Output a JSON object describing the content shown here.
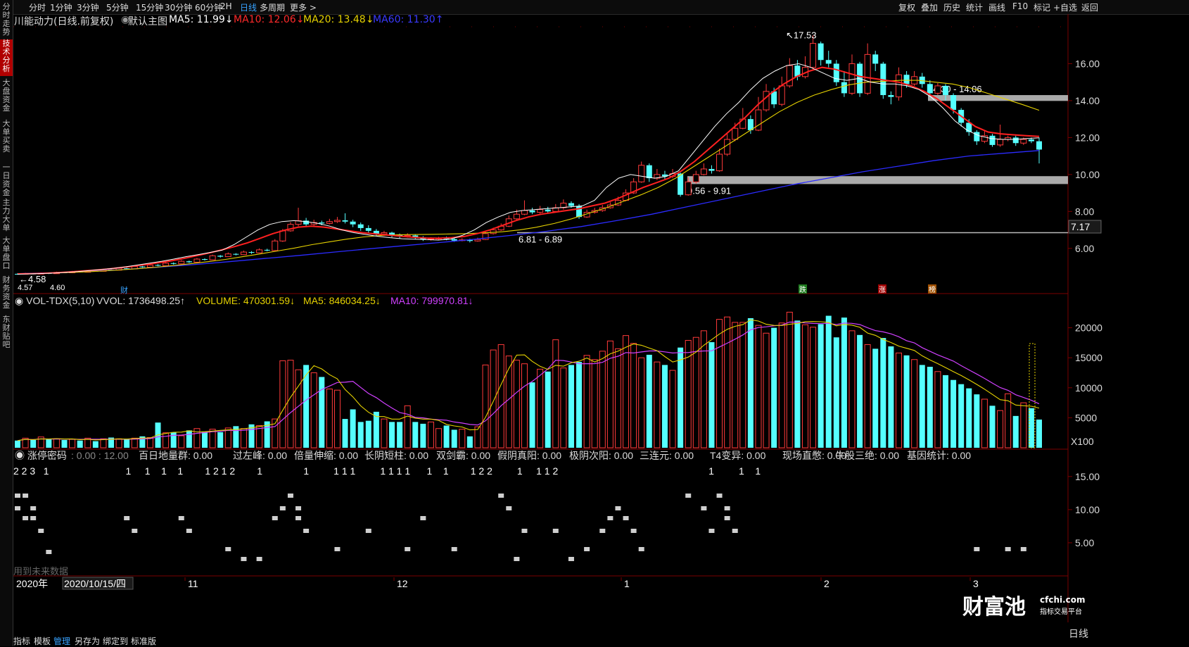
{
  "sidebar": {
    "tabs": [
      {
        "label": "分时走势",
        "active": false
      },
      {
        "label": "技术分析",
        "active": true
      },
      {
        "label": "大盘资金",
        "active": false
      },
      {
        "label": "大单买卖",
        "active": false
      },
      {
        "label": "一日资金",
        "active": false
      },
      {
        "label": "主力大单",
        "active": false
      },
      {
        "label": "大单盘口",
        "active": false
      },
      {
        "label": "财务资金",
        "active": false
      },
      {
        "label": "东财贴吧",
        "active": false
      }
    ]
  },
  "topbar": {
    "periods": [
      "分时",
      "1分钟",
      "3分钟",
      "5分钟",
      "15分钟",
      "30分钟",
      "60分钟",
      "2H",
      "日线",
      "多周期",
      "更多 >"
    ],
    "selected_period": "日线",
    "tools": [
      "复权",
      "叠加",
      "历史",
      "统计",
      "画线",
      "F10",
      "标记",
      "+自选",
      "返回"
    ]
  },
  "main_indicator": {
    "stock": "川能动力(日线.前复权)",
    "mode": "默认主图",
    "ma5": "MA5: 11.99↓",
    "ma10": "MA10: 12.06↓",
    "ma20": "MA20: 13.48↓",
    "ma60": "MA60: 11.30↑",
    "colors": {
      "ma5": "#ffffff",
      "ma10": "#ff2a2a",
      "ma20": "#e6d200",
      "ma60": "#3a3aff"
    }
  },
  "price_axis": [
    "16.00",
    "14.00",
    "12.00",
    "10.00",
    "8.00",
    "6.00"
  ],
  "current_price_tag": "7.17",
  "annotations": {
    "high": "17.53",
    "low1": "4.58",
    "low2": "4.57",
    "low3": "4.60",
    "zone1": "14.30 - 14.06",
    "zone2": "9.56 - 9.91",
    "zone3": "6.81 - 6.89",
    "tag_cai": "财",
    "tag_die": "跌",
    "tag_zhang": "涨",
    "tag_bang": "榜"
  },
  "volume_indicator": {
    "name": "VOL-TDX(5,10)",
    "vvol": "VVOL: 1736498.25↑",
    "volume": "VOLUME: 470301.59↓",
    "ma5": "MA5: 846034.25↓",
    "ma10": "MA10: 799970.81↓",
    "axis": [
      "20000",
      "15000",
      "10000",
      "5000"
    ],
    "unit": "X100"
  },
  "code_indicator": {
    "name": "涨停密码",
    "range": ": 0.00 : 12.00",
    "items": [
      "百日地量群: 0.00",
      "过左峰: 0.00",
      "倍量伸缩: 0.00",
      "长阴短柱: 0.00",
      "双剑霸: 0.00",
      "假阴真阳: 0.00",
      "极阴次阳: 0.00",
      "三连元: 0.00",
      "T4变异: 0.00",
      "现场直憋: 0.00",
      "牛股三绝: 0.00",
      "基因统计: 0.00"
    ],
    "axis": [
      "15.00",
      "10.00",
      "5.00"
    ],
    "digits": "2 2 3   1                            1     1    1    1        1 2 1 2        1               1         1 1 1         1 1 1 1      1    1        1 2 2         1     1 1 2                                                       1         1    1",
    "footnote": "用到未来数据"
  },
  "time_axis": {
    "year": "2020年",
    "cursor_date": "2020/10/15/四",
    "months": [
      "11",
      "12",
      "1",
      "2",
      "3"
    ]
  },
  "bottom_tabs": [
    "指标",
    "模板",
    "管理",
    "另存为",
    "绑定到",
    "标准版"
  ],
  "selected_bottom_tab": "管理",
  "period_label": "日线",
  "logo": {
    "name": "财富池",
    "site": "cfchi.com",
    "slogan": "指标交易平台"
  },
  "chart_data": {
    "type": "candlestick",
    "y_price_range": [
      4.2,
      18.0
    ],
    "candles": [
      [
        4.62,
        4.58,
        4.66,
        4.57
      ],
      [
        4.6,
        4.64,
        4.68,
        4.58
      ],
      [
        4.63,
        4.61,
        4.67,
        4.59
      ],
      [
        4.61,
        4.66,
        4.7,
        4.6
      ],
      [
        4.66,
        4.63,
        4.69,
        4.61
      ],
      [
        4.63,
        4.7,
        4.74,
        4.62
      ],
      [
        4.7,
        4.68,
        4.73,
        4.66
      ],
      [
        4.68,
        4.74,
        4.78,
        4.67
      ],
      [
        4.74,
        4.71,
        4.76,
        4.69
      ],
      [
        4.71,
        4.78,
        4.82,
        4.7
      ],
      [
        4.78,
        4.76,
        4.81,
        4.74
      ],
      [
        4.76,
        4.85,
        4.9,
        4.75
      ],
      [
        4.85,
        4.82,
        4.88,
        4.8
      ],
      [
        4.82,
        4.92,
        4.96,
        4.81
      ],
      [
        4.92,
        4.89,
        4.95,
        4.86
      ],
      [
        4.89,
        5.02,
        5.08,
        4.88
      ],
      [
        5.02,
        4.98,
        5.05,
        4.95
      ],
      [
        4.98,
        5.1,
        5.15,
        4.97
      ],
      [
        5.1,
        5.06,
        5.14,
        5.03
      ],
      [
        5.06,
        5.2,
        5.26,
        5.05
      ],
      [
        5.2,
        5.16,
        5.24,
        5.12
      ],
      [
        5.16,
        5.3,
        5.36,
        5.15
      ],
      [
        5.3,
        5.25,
        5.34,
        5.21
      ],
      [
        5.25,
        5.42,
        5.48,
        5.24
      ],
      [
        5.42,
        5.38,
        5.46,
        5.34
      ],
      [
        5.38,
        5.6,
        5.66,
        5.37
      ],
      [
        5.6,
        5.55,
        5.64,
        5.5
      ],
      [
        5.55,
        5.7,
        5.78,
        5.54
      ],
      [
        5.7,
        5.66,
        5.74,
        5.62
      ],
      [
        5.66,
        5.8,
        5.88,
        5.65
      ],
      [
        5.8,
        5.76,
        5.85,
        5.7
      ],
      [
        5.76,
        5.92,
        6.0,
        5.74
      ],
      [
        5.92,
        5.88,
        5.98,
        5.84
      ],
      [
        5.88,
        6.4,
        6.5,
        5.86
      ],
      [
        6.4,
        6.95,
        7.05,
        6.35
      ],
      [
        6.95,
        7.3,
        7.42,
        6.9
      ],
      [
        7.3,
        7.5,
        8.2,
        7.2
      ],
      [
        7.5,
        7.3,
        7.65,
        7.15
      ],
      [
        7.3,
        7.4,
        7.55,
        7.22
      ],
      [
        7.4,
        7.35,
        7.5,
        7.25
      ],
      [
        7.35,
        7.45,
        7.6,
        7.3
      ],
      [
        7.45,
        7.52,
        7.7,
        7.38
      ],
      [
        7.52,
        7.45,
        7.9,
        7.35
      ],
      [
        7.45,
        7.3,
        7.55,
        7.15
      ],
      [
        7.3,
        7.1,
        7.4,
        6.95
      ],
      [
        7.1,
        6.95,
        7.25,
        6.8
      ],
      [
        6.95,
        6.78,
        7.05,
        6.7
      ],
      [
        6.78,
        6.85,
        6.95,
        6.68
      ],
      [
        6.85,
        6.72,
        6.9,
        6.6
      ],
      [
        6.72,
        6.65,
        6.8,
        6.55
      ],
      [
        6.65,
        6.7,
        6.82,
        6.58
      ],
      [
        6.7,
        6.6,
        6.76,
        6.5
      ],
      [
        6.6,
        6.48,
        6.66,
        6.4
      ],
      [
        6.48,
        6.52,
        6.6,
        6.42
      ],
      [
        6.52,
        6.55,
        6.62,
        6.45
      ],
      [
        6.55,
        6.5,
        6.64,
        6.44
      ],
      [
        6.5,
        6.42,
        6.58,
        6.35
      ],
      [
        6.42,
        6.46,
        6.55,
        6.38
      ],
      [
        6.46,
        6.4,
        6.52,
        6.32
      ],
      [
        6.4,
        6.48,
        6.58,
        6.36
      ],
      [
        6.48,
        6.8,
        6.92,
        6.45
      ],
      [
        6.8,
        7.0,
        7.12,
        6.75
      ],
      [
        7.0,
        7.2,
        7.35,
        6.95
      ],
      [
        7.2,
        7.6,
        7.78,
        7.15
      ],
      [
        7.6,
        7.85,
        8.1,
        7.55
      ],
      [
        7.85,
        8.05,
        8.6,
        7.8
      ],
      [
        8.05,
        7.95,
        8.2,
        7.85
      ],
      [
        7.95,
        8.1,
        8.3,
        7.88
      ],
      [
        8.1,
        8.0,
        8.25,
        7.9
      ],
      [
        8.0,
        8.2,
        8.4,
        7.95
      ],
      [
        8.2,
        8.45,
        8.65,
        8.1
      ],
      [
        8.45,
        8.3,
        8.55,
        8.2
      ],
      [
        8.3,
        7.7,
        8.4,
        7.6
      ],
      [
        7.7,
        7.95,
        8.1,
        7.65
      ],
      [
        7.95,
        8.05,
        8.2,
        7.88
      ],
      [
        8.05,
        8.2,
        8.35,
        7.98
      ],
      [
        8.2,
        8.35,
        8.5,
        8.15
      ],
      [
        8.35,
        8.6,
        8.8,
        8.3
      ],
      [
        8.6,
        9.0,
        9.2,
        8.55
      ],
      [
        9.0,
        9.6,
        9.8,
        8.95
      ],
      [
        9.6,
        10.5,
        10.7,
        9.55
      ],
      [
        10.5,
        9.8,
        10.6,
        9.6
      ],
      [
        9.8,
        10.0,
        10.3,
        9.7
      ],
      [
        10.0,
        9.9,
        10.2,
        9.75
      ],
      [
        9.9,
        10.05,
        10.3,
        9.8
      ],
      [
        10.05,
        8.9,
        10.1,
        8.8
      ],
      [
        8.9,
        9.6,
        9.85,
        8.85
      ],
      [
        9.6,
        10.0,
        10.2,
        9.5
      ],
      [
        10.0,
        10.3,
        10.6,
        9.95
      ],
      [
        10.3,
        10.2,
        10.5,
        10.05
      ],
      [
        10.2,
        11.1,
        11.4,
        10.15
      ],
      [
        11.1,
        11.9,
        12.2,
        11.0
      ],
      [
        11.9,
        12.5,
        12.8,
        11.8
      ],
      [
        12.5,
        13.0,
        13.6,
        12.45
      ],
      [
        13.0,
        12.4,
        13.2,
        12.2
      ],
      [
        12.4,
        13.5,
        14.2,
        12.35
      ],
      [
        13.5,
        14.5,
        14.9,
        13.4
      ],
      [
        14.5,
        13.8,
        14.7,
        13.6
      ],
      [
        13.8,
        14.8,
        15.3,
        13.7
      ],
      [
        14.8,
        15.9,
        16.3,
        14.7
      ],
      [
        15.9,
        15.3,
        16.2,
        15.1
      ],
      [
        15.3,
        15.8,
        16.4,
        15.2
      ],
      [
        15.8,
        17.1,
        17.53,
        15.7
      ],
      [
        17.1,
        16.2,
        17.2,
        15.9
      ],
      [
        16.2,
        16.0,
        16.7,
        15.8
      ],
      [
        16.0,
        15.0,
        16.2,
        14.8
      ],
      [
        15.0,
        14.4,
        15.6,
        14.2
      ],
      [
        14.4,
        16.0,
        16.5,
        14.3
      ],
      [
        16.0,
        14.4,
        16.1,
        14.2
      ],
      [
        14.4,
        16.5,
        17.1,
        14.3
      ],
      [
        16.5,
        16.0,
        16.7,
        15.6
      ],
      [
        16.0,
        14.3,
        16.1,
        14.1
      ],
      [
        14.3,
        14.2,
        14.5,
        13.8
      ],
      [
        14.2,
        15.4,
        15.8,
        14.0
      ],
      [
        15.4,
        14.9,
        15.6,
        14.7
      ],
      [
        14.9,
        15.3,
        15.6,
        14.8
      ],
      [
        15.3,
        14.9,
        15.5,
        14.7
      ],
      [
        14.9,
        14.4,
        15.1,
        14.2
      ],
      [
        14.4,
        14.8,
        14.95,
        14.3
      ],
      [
        14.8,
        14.3,
        14.9,
        14.0
      ],
      [
        14.3,
        13.5,
        14.4,
        13.3
      ],
      [
        13.5,
        12.8,
        13.6,
        12.6
      ],
      [
        12.8,
        12.3,
        13.0,
        12.1
      ],
      [
        12.3,
        11.8,
        12.4,
        11.6
      ],
      [
        11.8,
        12.1,
        12.4,
        11.7
      ],
      [
        12.1,
        11.6,
        12.2,
        11.5
      ],
      [
        11.6,
        11.9,
        12.7,
        11.5
      ],
      [
        11.9,
        12.0,
        12.1,
        11.8
      ],
      [
        12.0,
        11.7,
        12.1,
        11.55
      ],
      [
        11.7,
        11.9,
        12.0,
        11.6
      ],
      [
        11.9,
        11.8,
        12.0,
        11.7
      ],
      [
        11.8,
        11.35,
        12.0,
        10.6
      ]
    ],
    "volumes": [
      1200,
      1600,
      1300,
      1800,
      1400,
      1500,
      1300,
      1400,
      1200,
      1600,
      1100,
      1500,
      1700,
      1500,
      1400,
      1600,
      1900,
      1700,
      4200,
      2500,
      2600,
      2000,
      2900,
      3200,
      2700,
      3100,
      2600,
      3300,
      3600,
      3200,
      3900,
      3700,
      4400,
      4800,
      14500,
      14600,
      13000,
      13800,
      12500,
      11800,
      9800,
      9600,
      4800,
      6400,
      4300,
      4500,
      6000,
      4800,
      4300,
      4300,
      7000,
      4300,
      4000,
      4300,
      3200,
      3700,
      3000,
      3100,
      1900,
      3500,
      13800,
      16300,
      17200,
      15300,
      14600,
      14000,
      10900,
      13100,
      12700,
      18000,
      13300,
      13800,
      14300,
      15400,
      14700,
      16100,
      17800,
      16500,
      18700,
      17400,
      15000,
      15500,
      14300,
      13800,
      12900,
      16700,
      17900,
      18400,
      19500,
      17600,
      21400,
      21800,
      20900,
      20900,
      21600,
      20400,
      19100,
      20000,
      20800,
      22600,
      21200,
      20500,
      20100,
      20600,
      22000,
      18400,
      21700,
      19500,
      18800,
      17200,
      16500,
      18300,
      16900,
      15800,
      15400,
      14700,
      13800,
      13500,
      12700,
      12100,
      11300,
      10600,
      9900,
      8900,
      8100,
      7000,
      6200,
      9000,
      5300,
      7500,
      6600,
      4700
    ],
    "ma5": [
      4.6,
      4.62,
      4.64,
      4.66,
      4.7,
      4.74,
      4.8,
      4.86,
      4.92,
      5.0,
      5.1,
      5.2,
      5.3,
      5.42,
      5.55,
      5.66,
      5.78,
      5.9,
      6.2,
      6.6,
      7.0,
      7.3,
      7.45,
      7.5,
      7.45,
      7.35,
      7.2,
      7.0,
      6.85,
      6.75,
      6.65,
      6.58,
      6.52,
      6.5,
      6.48,
      6.45,
      6.5,
      6.7,
      7.0,
      7.4,
      7.7,
      7.95,
      8.05,
      8.1,
      8.15,
      8.2,
      8.25,
      8.3,
      8.6,
      9.3,
      9.8,
      10.0,
      9.9,
      9.8,
      9.9,
      10.2,
      11.0,
      11.8,
      12.6,
      13.3,
      13.9,
      14.6,
      15.2,
      15.6,
      15.9,
      16.0,
      15.8,
      15.5,
      15.2,
      15.1,
      15.2,
      15.0,
      14.9,
      14.9,
      14.8,
      14.6,
      14.2,
      13.6,
      12.9,
      12.4,
      12.1,
      11.95,
      11.9,
      11.9,
      11.95,
      11.99
    ],
    "ma10": [
      4.62,
      4.63,
      4.65,
      4.68,
      4.72,
      4.77,
      4.82,
      4.88,
      4.95,
      5.03,
      5.12,
      5.22,
      5.32,
      5.45,
      5.6,
      5.75,
      5.92,
      6.1,
      6.3,
      6.55,
      6.8,
      7.0,
      7.15,
      7.2,
      7.15,
      7.05,
      6.95,
      6.85,
      6.78,
      6.72,
      6.66,
      6.6,
      6.56,
      6.55,
      6.58,
      6.65,
      6.8,
      7.0,
      7.25,
      7.5,
      7.7,
      7.85,
      7.95,
      8.05,
      8.15,
      8.3,
      8.45,
      8.7,
      9.0,
      9.3,
      9.55,
      9.8,
      10.2,
      10.7,
      11.3,
      11.9,
      12.5,
      13.1,
      13.8,
      14.4,
      14.9,
      15.3,
      15.6,
      15.8,
      15.7,
      15.5,
      15.3,
      15.2,
      15.1,
      15.0,
      14.8,
      14.5,
      14.1,
      13.6,
      13.1,
      12.6,
      12.3,
      12.2,
      12.15,
      12.1,
      12.06
    ],
    "ma20": [
      4.63,
      4.64,
      4.66,
      4.69,
      4.73,
      4.78,
      4.84,
      4.9,
      4.98,
      5.07,
      5.17,
      5.28,
      5.4,
      5.55,
      5.7,
      5.86,
      6.02,
      6.2,
      6.35,
      6.5,
      6.62,
      6.7,
      6.74,
      6.75,
      6.76,
      6.78,
      6.8,
      6.84,
      6.9,
      7.0,
      7.15,
      7.35,
      7.6,
      7.9,
      8.2,
      8.55,
      8.9,
      9.3,
      9.8,
      10.4,
      11.0,
      11.6,
      12.2,
      12.8,
      13.4,
      13.9,
      14.3,
      14.6,
      14.85,
      15.0,
      15.05,
      15.1,
      15.1,
      15.0,
      14.9,
      14.7,
      14.4,
      14.1,
      13.8,
      13.48
    ],
    "ma60": [
      4.63,
      4.68,
      4.75,
      4.85,
      4.98,
      5.12,
      5.28,
      5.45,
      5.62,
      5.8,
      5.98,
      6.15,
      6.32,
      6.5,
      6.7,
      6.92,
      7.18,
      7.5,
      7.85,
      8.25,
      8.65,
      9.05,
      9.45,
      9.8,
      10.15,
      10.45,
      10.75,
      11.0,
      11.15,
      11.3
    ]
  }
}
